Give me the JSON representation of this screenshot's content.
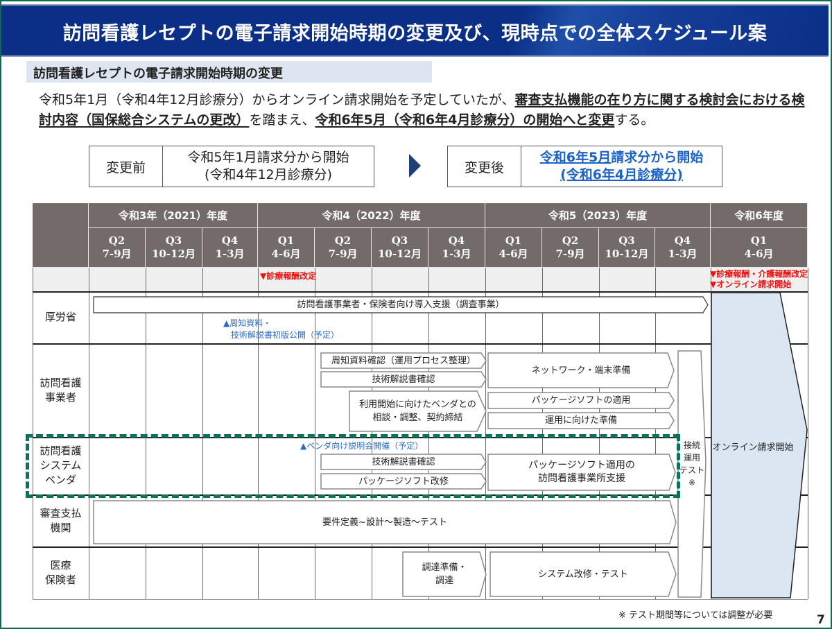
{
  "slide": {
    "title": "訪問看護レセプトの電子請求開始時期の変更及び、現時点での全体スケジュール案",
    "section_heading": "訪問看護レセプトの電子請求開始時期の変更",
    "description": {
      "p1": "令和5年1月（令和4年12月診療分）からオンライン請求開始を予定していたが、",
      "p1_bold": "審査支払機能の在り方に関する検討会における検討内容（国保総合システムの更改）",
      "p2": "を踏まえ、",
      "p2_bold": "令和6年5月（令和6年4月診療分）の開始へと変更",
      "p3": "する。"
    },
    "before_box": {
      "label": "変更前",
      "line1": "令和5年1月請求分から開始",
      "line2": "(令和4年12月診療分)"
    },
    "after_box": {
      "label": "変更後",
      "line1_highlight": "令和6年5月",
      "line1_rest": "請求分から開始",
      "line2": "(令和6年4月診療分)"
    },
    "footnote": "※ テスト期間等については調整が必要",
    "page_number": "7"
  },
  "schedule": {
    "fiscal_years": [
      {
        "label": "令和3年（2021）年度"
      },
      {
        "label": "令和4（2022）年度"
      },
      {
        "label": "令和5（2023）年度"
      },
      {
        "label": "令和6年度"
      }
    ],
    "quarters": [
      {
        "q": "Q2",
        "months": "7-9月"
      },
      {
        "q": "Q3",
        "months": "10-12月"
      },
      {
        "q": "Q4",
        "months": "1-3月"
      },
      {
        "q": "Q1",
        "months": "4-6月"
      },
      {
        "q": "Q2",
        "months": "7-9月"
      },
      {
        "q": "Q3",
        "months": "10-12月"
      },
      {
        "q": "Q4",
        "months": "1-3月"
      },
      {
        "q": "Q1",
        "months": "4-6月"
      },
      {
        "q": "Q2",
        "months": "7-9月"
      },
      {
        "q": "Q3",
        "months": "10-12月"
      },
      {
        "q": "Q4",
        "months": "1-3月"
      },
      {
        "q": "Q1",
        "months": "4-6月"
      }
    ],
    "events": {
      "fee_revision_2022": "▼診療報酬改定",
      "fee_revision_2024": "▼診療報酬・介護報酬改定",
      "online_start": "▼オンライン請求開始"
    },
    "rows": [
      {
        "label": "厚労省"
      },
      {
        "label": "訪問看護\n事業者"
      },
      {
        "label": "訪問看護\nシステム\nベンダ"
      },
      {
        "label": "審査支払\n機関"
      },
      {
        "label": "医療\n保険者"
      }
    ],
    "mhlw": {
      "support_bar": "訪問看護事業者・保険者向け導入支援（調査事業）",
      "note_line1": "▲周知資料・",
      "note_line2": "技術解説書初版公開（予定）"
    },
    "provider": {
      "bar1": "周知資料確認（運用プロセス整理）",
      "bar2": "技術解説書確認",
      "bar3_line1": "利用開始に向けたベンダとの",
      "bar3_line2": "相談・調整、契約締結",
      "bar4": "ネットワーク・端末準備",
      "bar5": "パッケージソフトの適用",
      "bar6": "運用に向けた準備"
    },
    "vendor": {
      "note": "▲ベンダ向け説明会開催（予定）",
      "bar1": "技術解説書確認",
      "bar2": "パッケージソフト改修",
      "bar3_line1": "パッケージソフト適用の",
      "bar3_line2": "訪問看護事業所支援"
    },
    "review_org": {
      "bar1": "要件定義~設計～製造～テスト"
    },
    "insurer": {
      "bar1_line1": "調達準備・",
      "bar1_line2": "調達",
      "bar2": "システム改修・テスト"
    },
    "connection_test": {
      "line1": "接続",
      "line2": "運用",
      "line3": "テスト",
      "line4": "※"
    },
    "online_start_bar": "オンライン請求開始"
  },
  "colors": {
    "title_bar": "#0b2f86",
    "header_gray": "#726b69",
    "event_red": "#f01010",
    "note_blue": "#2a6cc4",
    "highlight_fill": "#dce6f2",
    "dashed_green": "#0b735c",
    "frame_green": "#0f6b55"
  }
}
